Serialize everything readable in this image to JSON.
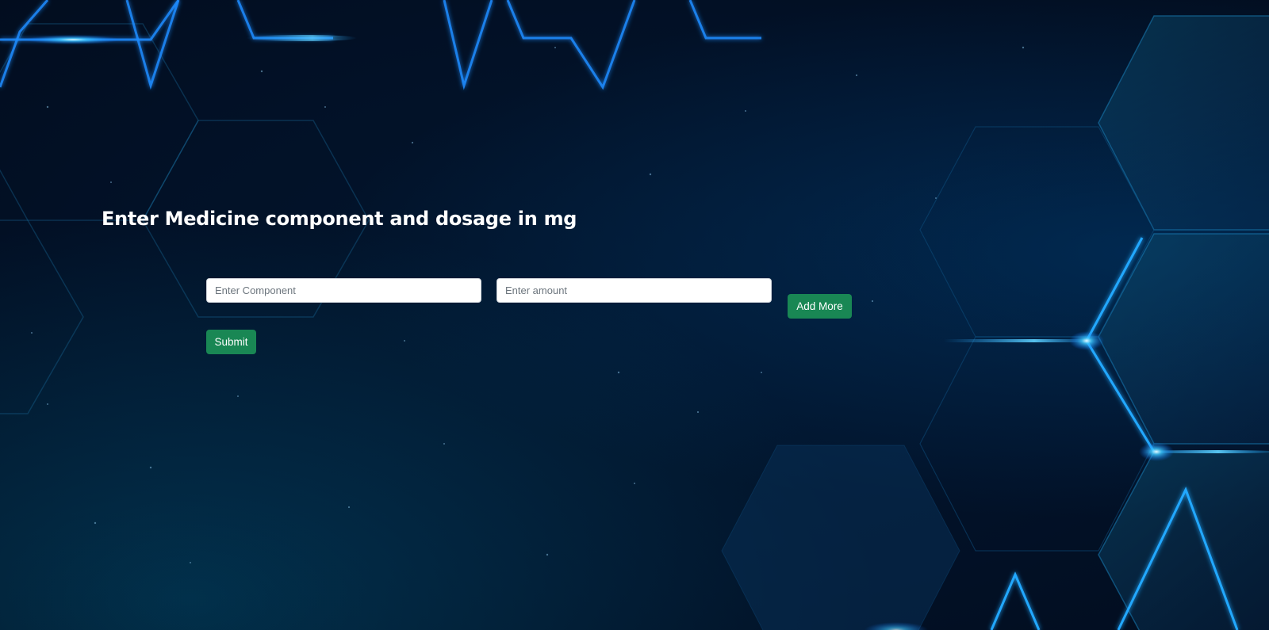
{
  "page": {
    "heading": "Enter Medicine component and dosage in mg"
  },
  "form": {
    "component_placeholder": "Enter Component",
    "amount_placeholder": "Enter amount",
    "component_value": "",
    "amount_value": "",
    "add_more_label": "Add More",
    "submit_label": "Submit"
  },
  "theme": {
    "background": "#021127",
    "accent_glow": "#1fa2ff",
    "button_color": "#198754",
    "heading_color": "#ffffff"
  },
  "background_art": {
    "description_icon": "hexagon-network-icon"
  }
}
